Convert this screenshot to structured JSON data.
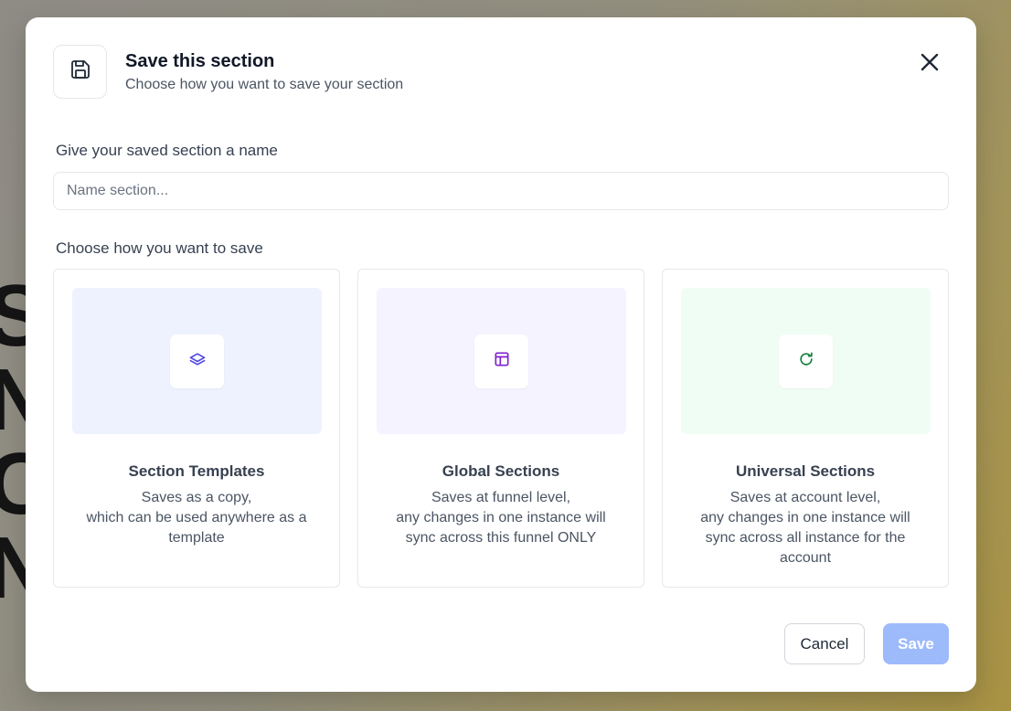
{
  "background": {
    "letters": [
      "S",
      "N",
      "C",
      "N"
    ]
  },
  "modal": {
    "header_icon": "floppy-disk-icon",
    "title": "Save this section",
    "subtitle": "Choose how you want to save your section",
    "close_icon": "close-icon"
  },
  "name_field": {
    "label": "Give your saved section a name",
    "placeholder": "Name section...",
    "value": ""
  },
  "save_options": {
    "label": "Choose how you want to save",
    "options": [
      {
        "title": "Section Templates",
        "icon": "layers-icon",
        "icon_color": "#4f46e5",
        "preview_bg": "#eef2ff",
        "description": [
          "Saves as a copy,",
          "which can be used anywhere as a",
          "template"
        ]
      },
      {
        "title": "Global Sections",
        "icon": "layout-icon",
        "icon_color": "#7e22ce",
        "preview_bg": "#f5f3ff",
        "description": [
          "Saves at funnel level,",
          "any changes in one instance will",
          "sync across this funnel ONLY"
        ]
      },
      {
        "title": "Universal Sections",
        "icon": "refresh-icon",
        "icon_color": "#15803d",
        "preview_bg": "#f0fdf4",
        "description": [
          "Saves at account level,",
          "any changes in one instance will",
          "sync across all instance for the",
          "account"
        ]
      }
    ]
  },
  "footer": {
    "cancel_label": "Cancel",
    "save_label": "Save",
    "save_color": "#9dbafa"
  }
}
